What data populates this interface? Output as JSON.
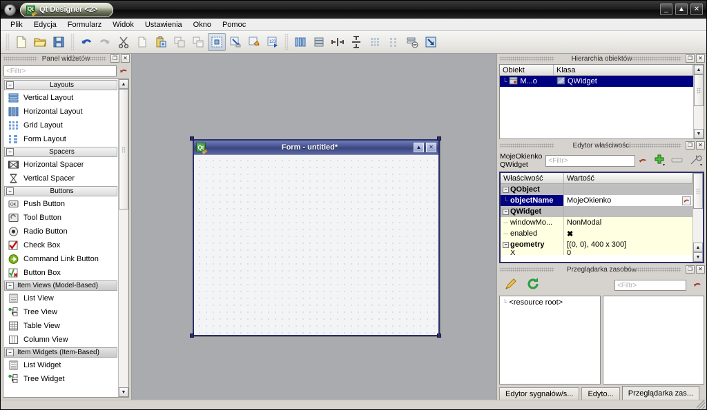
{
  "window": {
    "title": "Qt Designer <2>",
    "app_icon": "qt-logo-icon",
    "menu_button_icon": "window-menu-icon",
    "controls": [
      {
        "name": "minimize",
        "icon": "minimize-icon",
        "glyph": "_"
      },
      {
        "name": "maximize",
        "icon": "maximize-icon",
        "glyph": "▲"
      },
      {
        "name": "close",
        "icon": "close-icon",
        "glyph": "✕"
      }
    ]
  },
  "menubar": [
    {
      "label": "Plik",
      "accel": "P"
    },
    {
      "label": "Edycja",
      "accel": "E"
    },
    {
      "label": "Formularz",
      "accel": "F"
    },
    {
      "label": "Widok",
      "accel": "W"
    },
    {
      "label": "Ustawienia",
      "accel": "s"
    },
    {
      "label": "Okno",
      "accel": "O"
    },
    {
      "label": "Pomoc",
      "accel": "c"
    }
  ],
  "toolbar": {
    "groups": [
      {
        "name": "file",
        "buttons": [
          {
            "name": "new-form-button",
            "icon": "new-document-icon",
            "active": false
          },
          {
            "name": "open-form-button",
            "icon": "open-folder-icon",
            "active": false
          },
          {
            "name": "save-form-button",
            "icon": "save-disk-icon",
            "active": false
          }
        ]
      },
      {
        "name": "edit",
        "buttons": [
          {
            "name": "undo-button",
            "icon": "undo-arrow-icon",
            "active": false
          },
          {
            "name": "redo-button",
            "icon": "redo-arrow-icon",
            "active": false
          },
          {
            "name": "cut-button",
            "icon": "scissors-icon",
            "active": false
          },
          {
            "name": "copy-button",
            "icon": "copy-pages-icon",
            "active": false
          },
          {
            "name": "paste-button",
            "icon": "paste-clipboard-icon",
            "active": false
          },
          {
            "name": "clone-button",
            "icon": "clone-windows-icon",
            "active": false
          },
          {
            "name": "select-all-button",
            "icon": "select-all-icon",
            "active": false
          }
        ]
      },
      {
        "name": "modes",
        "buttons": [
          {
            "name": "edit-widgets-mode-button",
            "icon": "edit-widgets-icon",
            "active": true
          },
          {
            "name": "edit-signals-slots-mode-button",
            "icon": "signals-slots-icon",
            "active": false
          },
          {
            "name": "edit-buddies-mode-button",
            "icon": "buddies-icon",
            "active": false
          },
          {
            "name": "edit-tab-order-mode-button",
            "icon": "tab-order-icon",
            "active": false
          }
        ]
      },
      {
        "name": "layouts",
        "buttons": [
          {
            "name": "layout-horizontally-button",
            "icon": "layout-horizontal-icon",
            "active": false
          },
          {
            "name": "layout-vertically-button",
            "icon": "layout-vertical-icon",
            "active": false
          },
          {
            "name": "layout-splitter-horizontal-button",
            "icon": "splitter-horizontal-icon",
            "active": false
          },
          {
            "name": "layout-splitter-vertical-button",
            "icon": "splitter-vertical-icon",
            "active": false
          },
          {
            "name": "layout-grid-button",
            "icon": "layout-grid-icon",
            "active": false
          },
          {
            "name": "layout-form-button",
            "icon": "layout-form-icon",
            "active": false
          },
          {
            "name": "break-layout-button",
            "icon": "break-layout-icon",
            "active": false
          },
          {
            "name": "adjust-size-button",
            "icon": "adjust-size-icon",
            "active": false
          }
        ]
      }
    ]
  },
  "widget_box": {
    "title": "Panel widżetów",
    "filter_placeholder": "<Filtr>",
    "clear_filter_icon": "reset-arrow-icon",
    "dock_buttons": [
      {
        "name": "float",
        "icon": "undock-icon",
        "glyph": "❐"
      },
      {
        "name": "close",
        "icon": "close-icon",
        "glyph": "✕"
      }
    ],
    "categories": [
      {
        "label": "Layouts",
        "expander": "−",
        "selected": false,
        "items": [
          {
            "label": "Vertical Layout",
            "icon": "vertical-layout-icon"
          },
          {
            "label": "Horizontal Layout",
            "icon": "horizontal-layout-icon"
          },
          {
            "label": "Grid Layout",
            "icon": "grid-layout-icon"
          },
          {
            "label": "Form Layout",
            "icon": "form-layout-icon"
          }
        ]
      },
      {
        "label": "Spacers",
        "expander": "−",
        "selected": false,
        "items": [
          {
            "label": "Horizontal Spacer",
            "icon": "horizontal-spacer-icon"
          },
          {
            "label": "Vertical Spacer",
            "icon": "vertical-spacer-icon"
          }
        ]
      },
      {
        "label": "Buttons",
        "expander": "−",
        "selected": false,
        "items": [
          {
            "label": "Push Button",
            "icon": "push-button-icon"
          },
          {
            "label": "Tool Button",
            "icon": "tool-button-icon"
          },
          {
            "label": "Radio Button",
            "icon": "radio-button-icon"
          },
          {
            "label": "Check Box",
            "icon": "check-box-icon"
          },
          {
            "label": "Command Link Button",
            "icon": "command-link-button-icon"
          },
          {
            "label": "Button Box",
            "icon": "button-box-icon"
          }
        ]
      },
      {
        "label": "Item Views (Model-Based)",
        "expander": "−",
        "selected": true,
        "items": [
          {
            "label": "List View",
            "icon": "list-view-icon"
          },
          {
            "label": "Tree View",
            "icon": "tree-view-icon"
          },
          {
            "label": "Table View",
            "icon": "table-view-icon"
          },
          {
            "label": "Column View",
            "icon": "column-view-icon"
          }
        ]
      },
      {
        "label": "Item Widgets (Item-Based)",
        "expander": "−",
        "selected": true,
        "items": [
          {
            "label": "List Widget",
            "icon": "list-widget-icon"
          },
          {
            "label": "Tree Widget",
            "icon": "tree-widget-icon"
          }
        ]
      }
    ]
  },
  "form_window": {
    "title": "Form - untitled*",
    "icon": "qt-form-icon",
    "buttons": [
      {
        "name": "restore",
        "icon": "restore-icon",
        "glyph": "▲"
      },
      {
        "name": "close",
        "icon": "close-icon",
        "glyph": "✕"
      }
    ]
  },
  "object_inspector": {
    "title": "Hierarchia obiektów",
    "dock_buttons": [
      {
        "name": "float",
        "icon": "undock-icon",
        "glyph": "❐"
      },
      {
        "name": "close",
        "icon": "close-icon",
        "glyph": "✕"
      }
    ],
    "columns": [
      "Obiekt",
      "Klasa"
    ],
    "rows": [
      {
        "object": "M...o",
        "object_icon": "widget-tree-icon",
        "klass": "QWidget",
        "klass_icon": "qwidget-icon",
        "selected": true
      }
    ]
  },
  "property_editor": {
    "title": "Edytor właściwości",
    "dock_buttons": [
      {
        "name": "float",
        "icon": "undock-icon",
        "glyph": "❐"
      },
      {
        "name": "close",
        "icon": "close-icon",
        "glyph": "✕"
      }
    ],
    "object_name": "MojeOkienko",
    "object_class": "QWidget",
    "filter_placeholder": "<Filtr>",
    "clear_filter_icon": "reset-arrow-icon",
    "tool_buttons": [
      {
        "name": "add-dynamic-property-button",
        "icon": "plus-green-icon"
      },
      {
        "name": "remove-dynamic-property-button",
        "icon": "minus-gray-icon"
      },
      {
        "name": "configure-button",
        "icon": "wrench-icon"
      }
    ],
    "columns": [
      "Właściwość",
      "Wartość"
    ],
    "rows": [
      {
        "kind": "group",
        "name": "QObject",
        "value": "",
        "expander": "−"
      },
      {
        "kind": "prop",
        "name": "objectName",
        "value": "MojeOkienko",
        "selected": true,
        "reset_icon": "reset-arrow-icon"
      },
      {
        "kind": "group",
        "name": "QWidget",
        "value": "",
        "expander": "−"
      },
      {
        "kind": "prop",
        "name": "windowMo...",
        "value": "NonModal",
        "highlight": true
      },
      {
        "kind": "prop",
        "name": "enabled",
        "value": "✖",
        "highlight": true,
        "is_check": true
      },
      {
        "kind": "prop",
        "name": "geometry",
        "value": "[(0, 0), 400 x 300]",
        "highlight": true,
        "bold": true,
        "expander": "−"
      },
      {
        "kind": "prop",
        "name": "X",
        "value": "0",
        "highlight": true,
        "partial": true
      }
    ]
  },
  "resource_browser": {
    "title": "Przeglądarka zasobów",
    "dock_buttons": [
      {
        "name": "float",
        "icon": "undock-icon",
        "glyph": "❐"
      },
      {
        "name": "close",
        "icon": "close-icon",
        "glyph": "✕"
      }
    ],
    "tool_buttons": [
      {
        "name": "edit-resources-button",
        "icon": "pencil-icon"
      },
      {
        "name": "reload-button",
        "icon": "reload-green-icon"
      }
    ],
    "filter_placeholder": "<Filtr>",
    "clear_filter_icon": "reset-arrow-icon",
    "tree_root": "<resource root>",
    "tree_root_icon": "tree-branch-icon"
  },
  "bottom_tabs": [
    {
      "label": "Edytor sygnałów/s...",
      "active": false
    },
    {
      "label": "Edyto...",
      "active": false
    },
    {
      "label": "Przeglądarka zas...",
      "active": true
    }
  ],
  "colors": {
    "canvas_bg": "#a9abaf",
    "chrome_bg": "#d6d3ce",
    "selection_blue": "#000080",
    "form_border": "#2b2f6b",
    "property_highlight": "#ffffe1",
    "group_row": "#bfbfbf"
  }
}
